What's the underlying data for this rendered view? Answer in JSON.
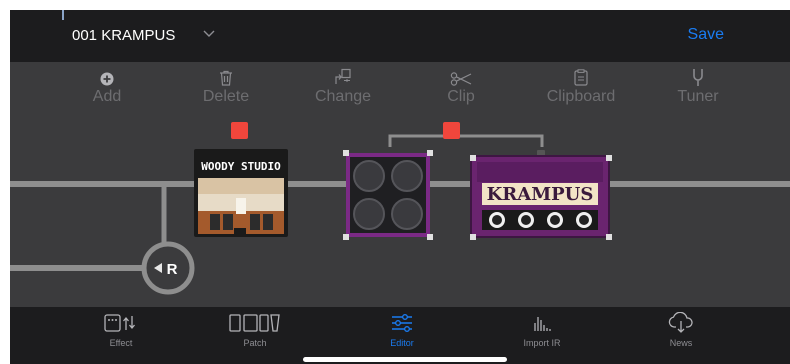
{
  "header": {
    "patch_name": "001 KRAMPUS",
    "save_label": "Save"
  },
  "toolbar": [
    {
      "id": "add",
      "label": "Add",
      "icon": "plus-circle-icon"
    },
    {
      "id": "delete",
      "label": "Delete",
      "icon": "trash-icon"
    },
    {
      "id": "change",
      "label": "Change",
      "icon": "swap-icon"
    },
    {
      "id": "clip",
      "label": "Clip",
      "icon": "scissors-icon"
    },
    {
      "id": "clipboard",
      "label": "Clipboard",
      "icon": "clipboard-icon"
    },
    {
      "id": "tuner",
      "label": "Tuner",
      "icon": "tuner-fork-icon"
    }
  ],
  "chain": {
    "ir_block": {
      "title": "WOODY STUDIO"
    },
    "amp_block": {
      "title": "KRAMPUS"
    },
    "return_node": {
      "label": "R"
    },
    "colors": {
      "selected_marker": "#f0463c",
      "cab_accent": "#7b2a86",
      "line": "#8e8e8e"
    }
  },
  "tabbar": [
    {
      "id": "effect",
      "label": "Effect",
      "icon": "effect-icon",
      "active": false
    },
    {
      "id": "patch",
      "label": "Patch",
      "icon": "patch-icon",
      "active": false
    },
    {
      "id": "editor",
      "label": "Editor",
      "icon": "editor-sliders-icon",
      "active": true
    },
    {
      "id": "import-ir",
      "label": "Import IR",
      "icon": "waveform-icon",
      "active": false
    },
    {
      "id": "news",
      "label": "News",
      "icon": "cloud-download-icon",
      "active": false
    }
  ],
  "colors": {
    "accent": "#1a7cf2",
    "background": "#3b3b3d",
    "bar": "#1c1c1e"
  }
}
